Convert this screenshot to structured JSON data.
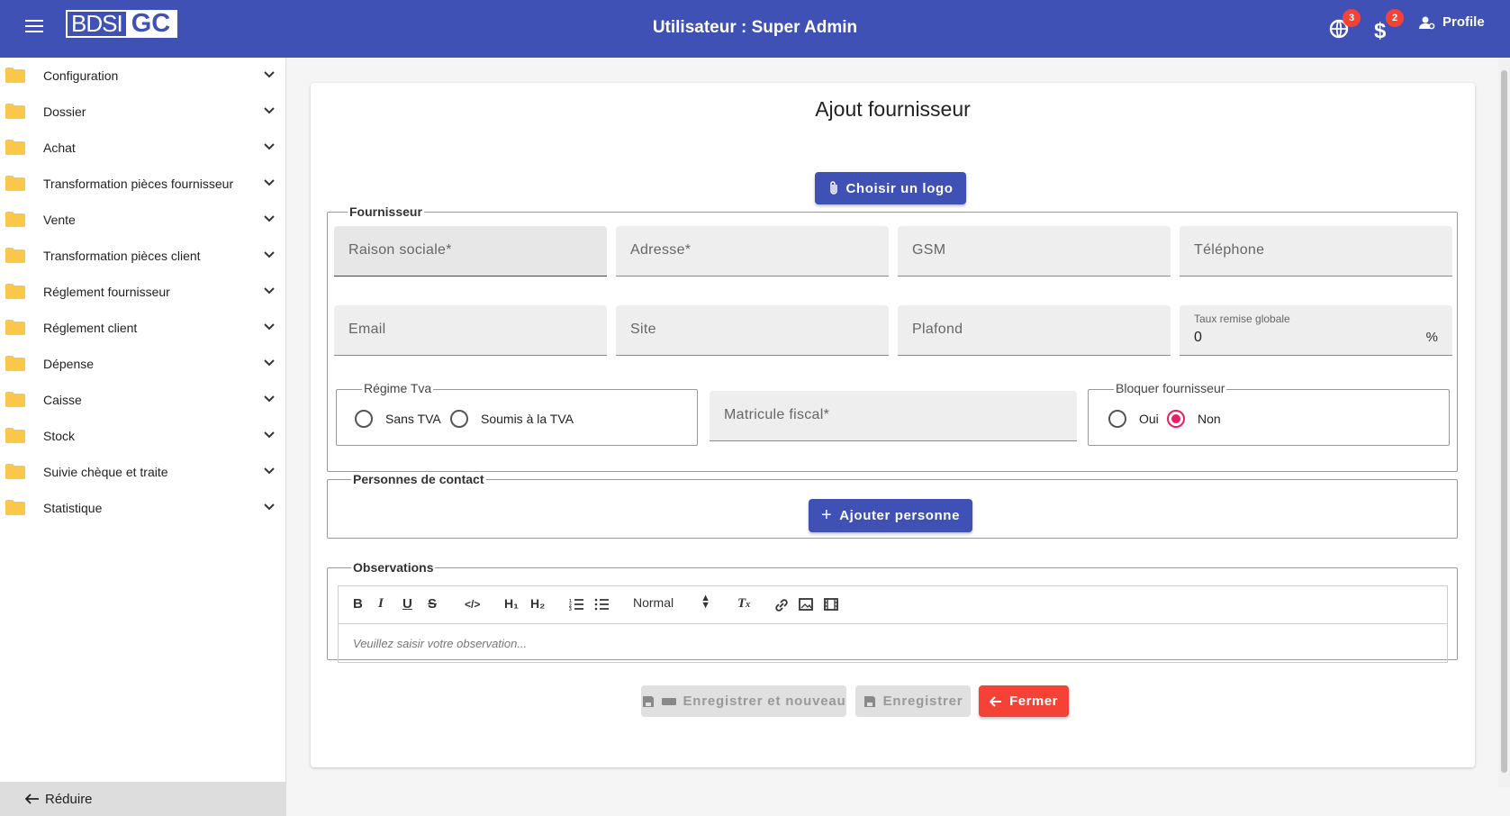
{
  "header": {
    "logo_left": "BDSI",
    "logo_right": "GC",
    "title": "Utilisateur : Super Admin",
    "notifications": [
      {
        "icon": "globe-settings-icon",
        "count": "3"
      },
      {
        "icon": "dollar-icon",
        "count": "2"
      }
    ],
    "profile_label": "Profile",
    "brand_color": "#3f51b5"
  },
  "sidebar": {
    "items": [
      {
        "label": "Configuration"
      },
      {
        "label": "Dossier"
      },
      {
        "label": "Achat"
      },
      {
        "label": "Transformation pièces fournisseur"
      },
      {
        "label": "Vente"
      },
      {
        "label": "Transformation pièces client"
      },
      {
        "label": "Réglement fournisseur"
      },
      {
        "label": "Réglement client"
      },
      {
        "label": "Dépense"
      },
      {
        "label": "Caisse"
      },
      {
        "label": "Stock"
      },
      {
        "label": "Suivie chèque et traite"
      },
      {
        "label": "Statistique"
      }
    ],
    "reduce_label": "Réduire"
  },
  "form": {
    "title": "Ajout fournisseur",
    "logo_button": "Choisir un logo",
    "fournisseur_legend": "Fournisseur",
    "fields": {
      "raison_sociale": "Raison sociale*",
      "adresse": "Adresse*",
      "gsm": "GSM",
      "telephone": "Téléphone",
      "email": "Email",
      "site": "Site",
      "plafond": "Plafond",
      "taux_label": "Taux remise globale",
      "taux_value": "0",
      "taux_suffix": "%",
      "matricule": "Matricule fiscal*"
    },
    "regime_tva": {
      "legend": "Régime Tva",
      "options": [
        "Sans TVA",
        "Soumis à la TVA"
      ],
      "selected": null
    },
    "bloquer": {
      "legend": "Bloquer fournisseur",
      "options": [
        "Oui",
        "Non"
      ],
      "selected": "Non"
    },
    "contacts_legend": "Personnes de contact",
    "add_person_button": "Ajouter personne",
    "observations_legend": "Observations",
    "editor": {
      "heading_select": "Normal",
      "placeholder": "Veuillez saisir votre observation..."
    },
    "actions": {
      "save_new": "Enregistrer et nouveau",
      "save": "Enregistrer",
      "close": "Fermer"
    }
  }
}
